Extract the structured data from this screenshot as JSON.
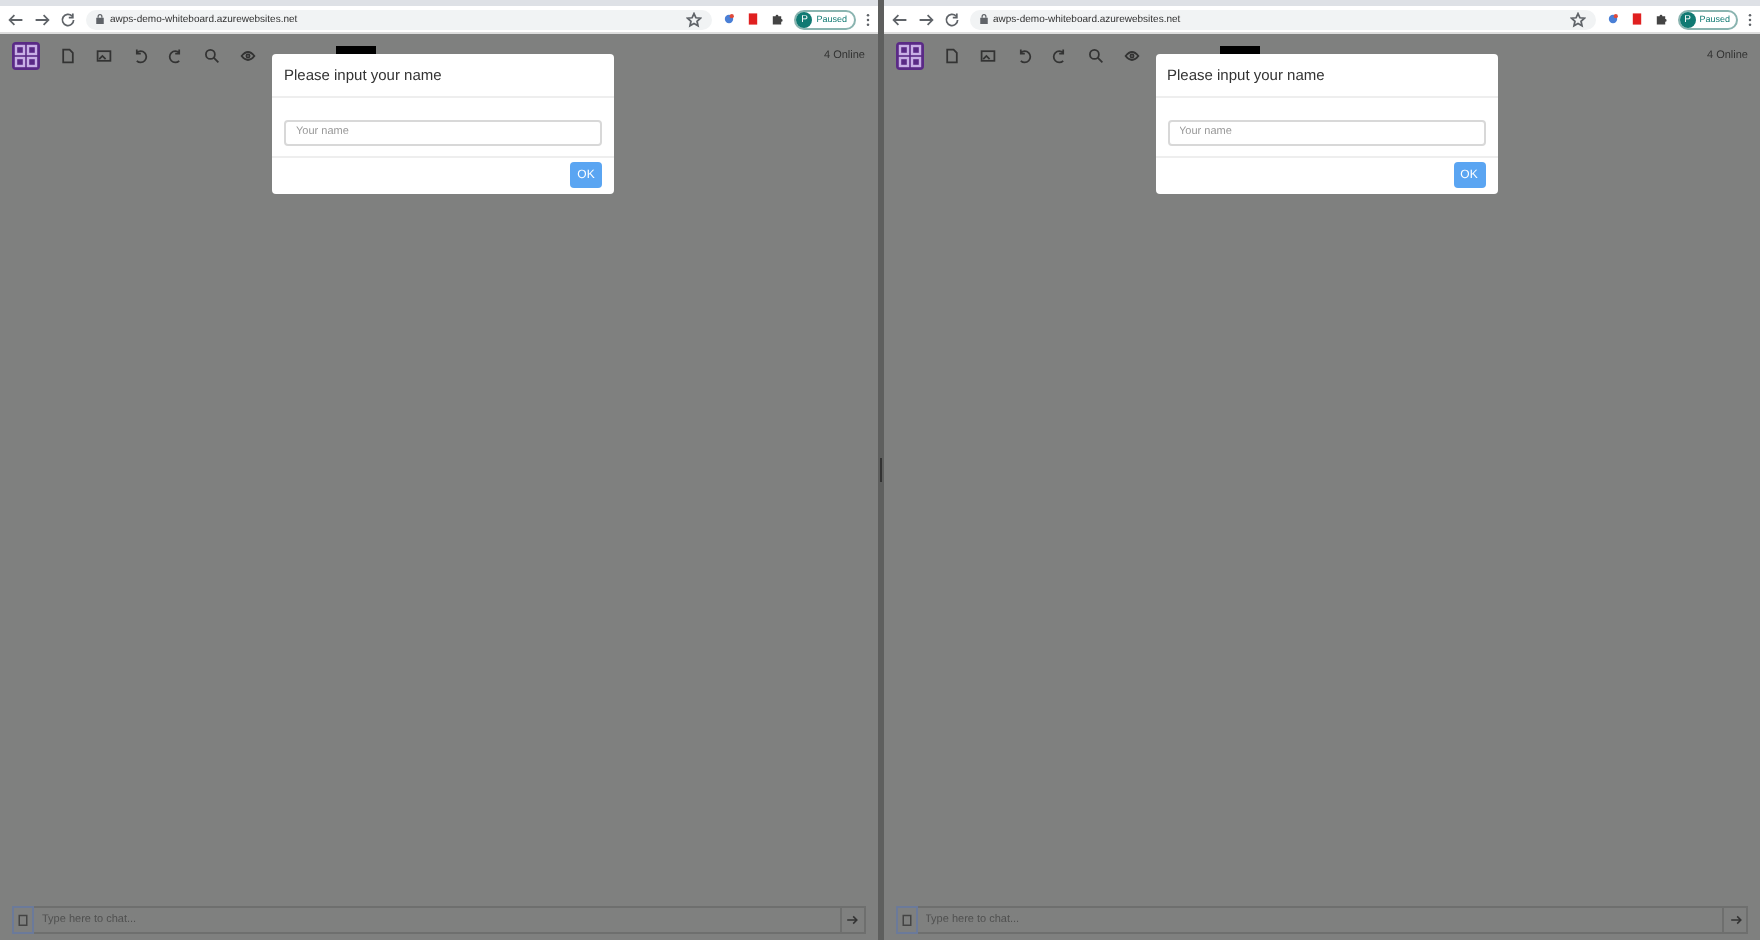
{
  "windows": [
    {
      "address_bar": {
        "url": "awps-demo-whiteboard.azurewebsites.net"
      },
      "profile": {
        "initial": "P",
        "status": "Paused"
      },
      "app": {
        "online": "4 Online",
        "dialog": {
          "title": "Please input your name",
          "name_field": {
            "placeholder": "Your name"
          },
          "ok_button": "OK"
        },
        "chat": {
          "placeholder": "Type here to chat..."
        }
      }
    },
    {
      "address_bar": {
        "url": "awps-demo-whiteboard.azurewebsites.net"
      },
      "profile": {
        "initial": "P",
        "status": "Paused"
      },
      "app": {
        "online": "4 Online",
        "dialog": {
          "title": "Please input your name",
          "name_field": {
            "placeholder": "Your name"
          },
          "ok_button": "OK"
        },
        "chat": {
          "placeholder": "Type here to chat..."
        }
      }
    }
  ]
}
